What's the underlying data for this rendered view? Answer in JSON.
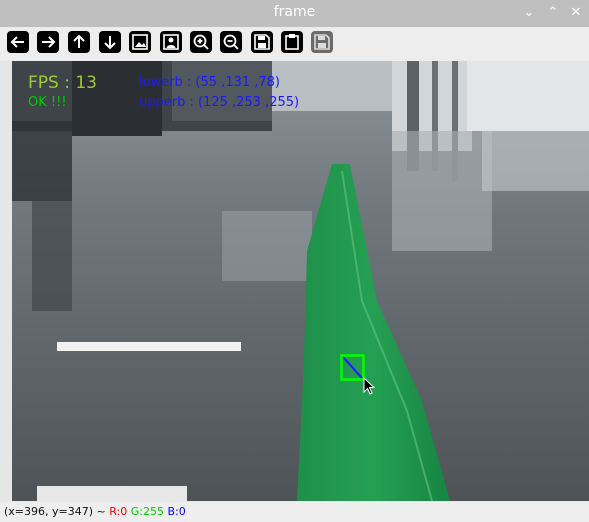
{
  "window": {
    "title": "frame",
    "controls": [
      "✕",
      "⌃",
      "⌄"
    ]
  },
  "toolbar": {
    "buttons": [
      {
        "name": "back-button",
        "icon": "arrow-left-icon"
      },
      {
        "name": "forward-button",
        "icon": "arrow-right-icon"
      },
      {
        "name": "pan-up-button",
        "icon": "arrow-up-icon"
      },
      {
        "name": "pan-down-button",
        "icon": "arrow-down-icon"
      },
      {
        "name": "zoom-to-window-button",
        "icon": "image-icon"
      },
      {
        "name": "zoom-to-image-button",
        "icon": "image-person-icon"
      },
      {
        "name": "zoom-in-button",
        "icon": "zoom-in-icon"
      },
      {
        "name": "zoom-out-button",
        "icon": "zoom-out-icon"
      },
      {
        "name": "save-button",
        "icon": "save-icon"
      },
      {
        "name": "copy-button",
        "icon": "clipboard-icon"
      },
      {
        "name": "properties-button",
        "icon": "properties-icon"
      }
    ]
  },
  "overlay": {
    "fps": "FPS : 13",
    "status": "OK !!!",
    "lowerb": "lowerb : (55 ,131 ,78)",
    "upperb": "upperb : (125 ,253 ,255)",
    "colors": {
      "fps": "#9acd32",
      "ok": "#00cc00",
      "bounds": "#1a1aff",
      "marker": "#00ff00"
    }
  },
  "statusbar": {
    "coords": "(x=396, y=347) ~ ",
    "r": "R:0",
    "g": "G:255",
    "b": "B:0",
    "colors": {
      "r": "#ff0000",
      "g": "#00cc00",
      "b": "#0000ff"
    }
  }
}
